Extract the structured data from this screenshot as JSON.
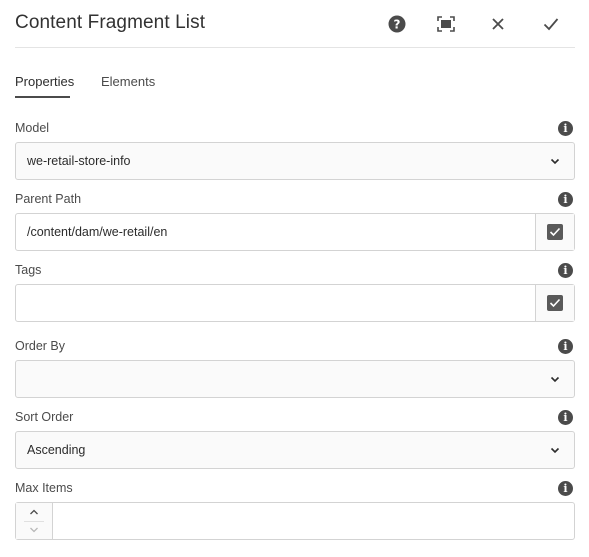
{
  "dialog": {
    "title": "Content Fragment List",
    "actions": {
      "help": "help-icon",
      "fullscreen": "fullscreen-icon",
      "close": "close-icon",
      "done": "checkmark-icon"
    }
  },
  "tabs": [
    {
      "label": "Properties",
      "active": true
    },
    {
      "label": "Elements",
      "active": false
    }
  ],
  "fields": {
    "model": {
      "label": "Model",
      "value": "we-retail-store-info"
    },
    "parent_path": {
      "label": "Parent Path",
      "value": "/content/dam/we-retail/en"
    },
    "tags": {
      "label": "Tags",
      "value": ""
    },
    "order_by": {
      "label": "Order By",
      "value": ""
    },
    "sort_order": {
      "label": "Sort Order",
      "value": "Ascending"
    },
    "max_items": {
      "label": "Max Items",
      "value": ""
    }
  },
  "colors": {
    "text": "#2c2c2c",
    "icon": "#4b4b4b",
    "border": "#d3d3d3",
    "field_bg": "#fafafa"
  }
}
